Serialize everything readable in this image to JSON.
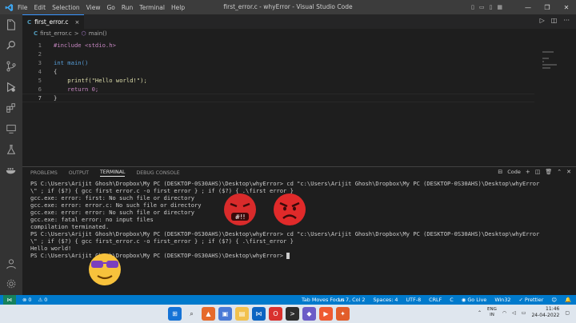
{
  "window": {
    "title": "first_error.c - whyError - Visual Studio Code",
    "menu": [
      "File",
      "Edit",
      "Selection",
      "View",
      "Go",
      "Run",
      "Terminal",
      "Help"
    ]
  },
  "activity_bar": [
    "explorer-icon",
    "search-icon",
    "source-control-icon",
    "run-debug-icon",
    "extensions-icon",
    "remote-icon",
    "testing-icon",
    "docker-icon",
    "account-icon",
    "settings-icon"
  ],
  "editor": {
    "tab_label": "first_error.c",
    "tab_close": "×",
    "breadcrumb": {
      "file": "first_error.c",
      "sep": ">",
      "symbol": "main()"
    },
    "lines": [
      {
        "num": "1",
        "text": "#include <stdio.h>"
      },
      {
        "num": "2",
        "text": ""
      },
      {
        "num": "3",
        "text": "int main()"
      },
      {
        "num": "4",
        "text": "{"
      },
      {
        "num": "5",
        "text": "    printf(\"Hello world!\");"
      },
      {
        "num": "6",
        "text": "    return 0;"
      },
      {
        "num": "7",
        "text": "}"
      }
    ]
  },
  "panel": {
    "tabs": [
      "PROBLEMS",
      "OUTPUT",
      "TERMINAL",
      "DEBUG CONSOLE"
    ],
    "active_tab": "TERMINAL",
    "shell_label": "Code",
    "terminal_lines": [
      "PS C:\\Users\\Arijit Ghosh\\Dropbox\\My PC (DESKTOP-0S30AHS)\\Desktop\\whyError> cd \"c:\\Users\\Arijit Ghosh\\Dropbox\\My PC (DESKTOP-0S30AHS)\\Desktop\\whyError",
      "\\\" ; if ($?) { gcc first error.c -o first error } ; if ($?) { .\\first error }",
      "gcc.exe: error: first: No such file or directory",
      "gcc.exe: error: error.c: No such file or directory",
      "gcc.exe: error: error: No such file or directory",
      "gcc.exe: fatal error: no input files",
      "compilation terminated.",
      "PS C:\\Users\\Arijit Ghosh\\Dropbox\\My PC (DESKTOP-0S30AHS)\\Desktop\\whyError> cd \"c:\\Users\\Arijit Ghosh\\Dropbox\\My PC (DESKTOP-0S30AHS)\\Desktop\\whyError",
      "\\\" ; if ($?) { gcc first_error.c -o first_error } ; if ($?) { .\\first_error }",
      "Hello world!",
      "PS C:\\Users\\Arijit Ghosh\\Dropbox\\My PC (DESKTOP-0S30AHS)\\Desktop\\whyError> "
    ]
  },
  "status_bar": {
    "errors": "0",
    "warnings": "0",
    "tab_moves_focus": "Tab Moves Focus",
    "position": "Ln 7, Col 2",
    "spaces": "Spaces: 4",
    "encoding": "UTF-8",
    "eol": "CRLF",
    "language": "C",
    "go_live": "Go Live",
    "platform": "Win32",
    "prettier": "Prettier"
  },
  "taskbar": {
    "lang_top": "ENG",
    "lang_bottom": "IN",
    "time": "11:46",
    "date": "24-04-2022"
  },
  "colors": {
    "accent": "#007acc",
    "titlebar": "#3c3c3c",
    "editor_bg": "#1e1e1e",
    "activity_bg": "#333333"
  }
}
